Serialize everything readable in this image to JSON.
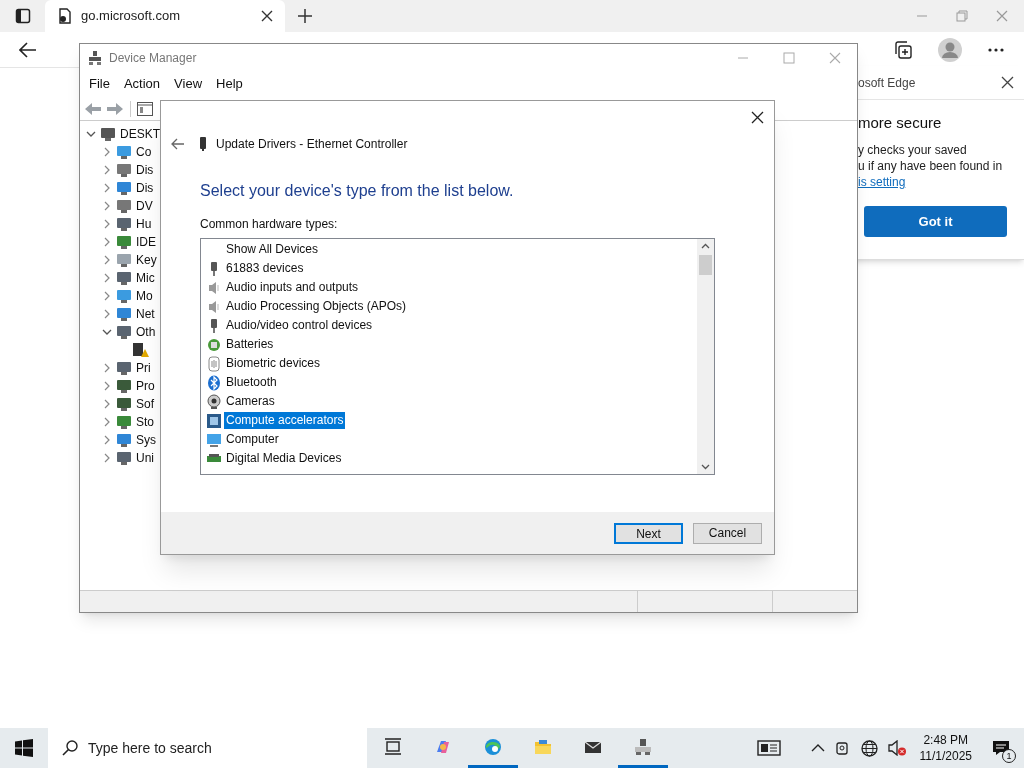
{
  "browser": {
    "tab_title": "go.microsoft.com"
  },
  "edge_popup": {
    "title": "osoft Edge",
    "heading": "more secure",
    "body_lines": [
      "y checks your saved",
      "u if any have been found in"
    ],
    "link": "is setting",
    "button": "Got it"
  },
  "device_manager": {
    "title": "Device Manager",
    "menu": [
      "File",
      "Action",
      "View",
      "Help"
    ],
    "tree": [
      {
        "label": "DESKT",
        "expanded": true,
        "children": [
          {
            "label": "Co",
            "expanded": false,
            "kind": "monitor"
          },
          {
            "label": "Dis",
            "expanded": false,
            "kind": "drive"
          },
          {
            "label": "Dis",
            "expanded": false,
            "kind": "display"
          },
          {
            "label": "DV",
            "expanded": false,
            "kind": "drive"
          },
          {
            "label": "Hu",
            "expanded": false,
            "kind": "hid"
          },
          {
            "label": "IDE",
            "expanded": false,
            "kind": "board"
          },
          {
            "label": "Key",
            "expanded": false,
            "kind": "keyboard"
          },
          {
            "label": "Mic",
            "expanded": false,
            "kind": "hid"
          },
          {
            "label": "Mo",
            "expanded": false,
            "kind": "monitor"
          },
          {
            "label": "Net",
            "expanded": false,
            "kind": "display"
          },
          {
            "label": "Oth",
            "expanded": true,
            "kind": "hid",
            "children": [
              {
                "kind": "warning"
              }
            ]
          },
          {
            "label": "Pri",
            "expanded": false,
            "kind": "hid"
          },
          {
            "label": "Pro",
            "expanded": false,
            "kind": "chip"
          },
          {
            "label": "Sof",
            "expanded": false,
            "kind": "chip"
          },
          {
            "label": "Sto",
            "expanded": false,
            "kind": "board"
          },
          {
            "label": "Sys",
            "expanded": false,
            "kind": "display"
          },
          {
            "label": "Uni",
            "expanded": false,
            "kind": "hid"
          }
        ]
      }
    ]
  },
  "dialog": {
    "title": "Update Drivers - Ethernet Controller",
    "heading": "Select your device's type from the list below.",
    "list_label": "Common hardware types:",
    "items": [
      {
        "label": "Show All Devices",
        "kind": "plain",
        "selected": false
      },
      {
        "label": "61883 devices",
        "kind": "device",
        "selected": false
      },
      {
        "label": "Audio inputs and outputs",
        "kind": "speaker",
        "selected": false
      },
      {
        "label": "Audio Processing Objects (APOs)",
        "kind": "speaker",
        "selected": false
      },
      {
        "label": "Audio/video control devices",
        "kind": "device",
        "selected": false
      },
      {
        "label": "Batteries",
        "kind": "battery",
        "selected": false
      },
      {
        "label": "Biometric devices",
        "kind": "fingerprint",
        "selected": false
      },
      {
        "label": "Bluetooth",
        "kind": "bluetooth",
        "selected": false
      },
      {
        "label": "Cameras",
        "kind": "camera",
        "selected": false
      },
      {
        "label": "Compute accelerators",
        "kind": "chip",
        "selected": true
      },
      {
        "label": "Computer",
        "kind": "monitor",
        "selected": false
      },
      {
        "label": "Digital Media Devices",
        "kind": "board",
        "selected": false
      }
    ],
    "buttons": [
      {
        "label": "Next",
        "default": true
      },
      {
        "label": "Cancel",
        "default": false
      }
    ]
  },
  "taskbar": {
    "search_placeholder": "Type here to search",
    "apps": [
      {
        "kind": "task-view",
        "active": false
      },
      {
        "kind": "copilot",
        "active": false
      },
      {
        "kind": "edge",
        "active": true
      },
      {
        "kind": "folder",
        "active": false
      },
      {
        "kind": "mail",
        "active": false
      },
      {
        "kind": "device-manager",
        "active": true
      }
    ],
    "time": "2:48 PM",
    "date": "11/1/2025",
    "notification_count": "1"
  }
}
